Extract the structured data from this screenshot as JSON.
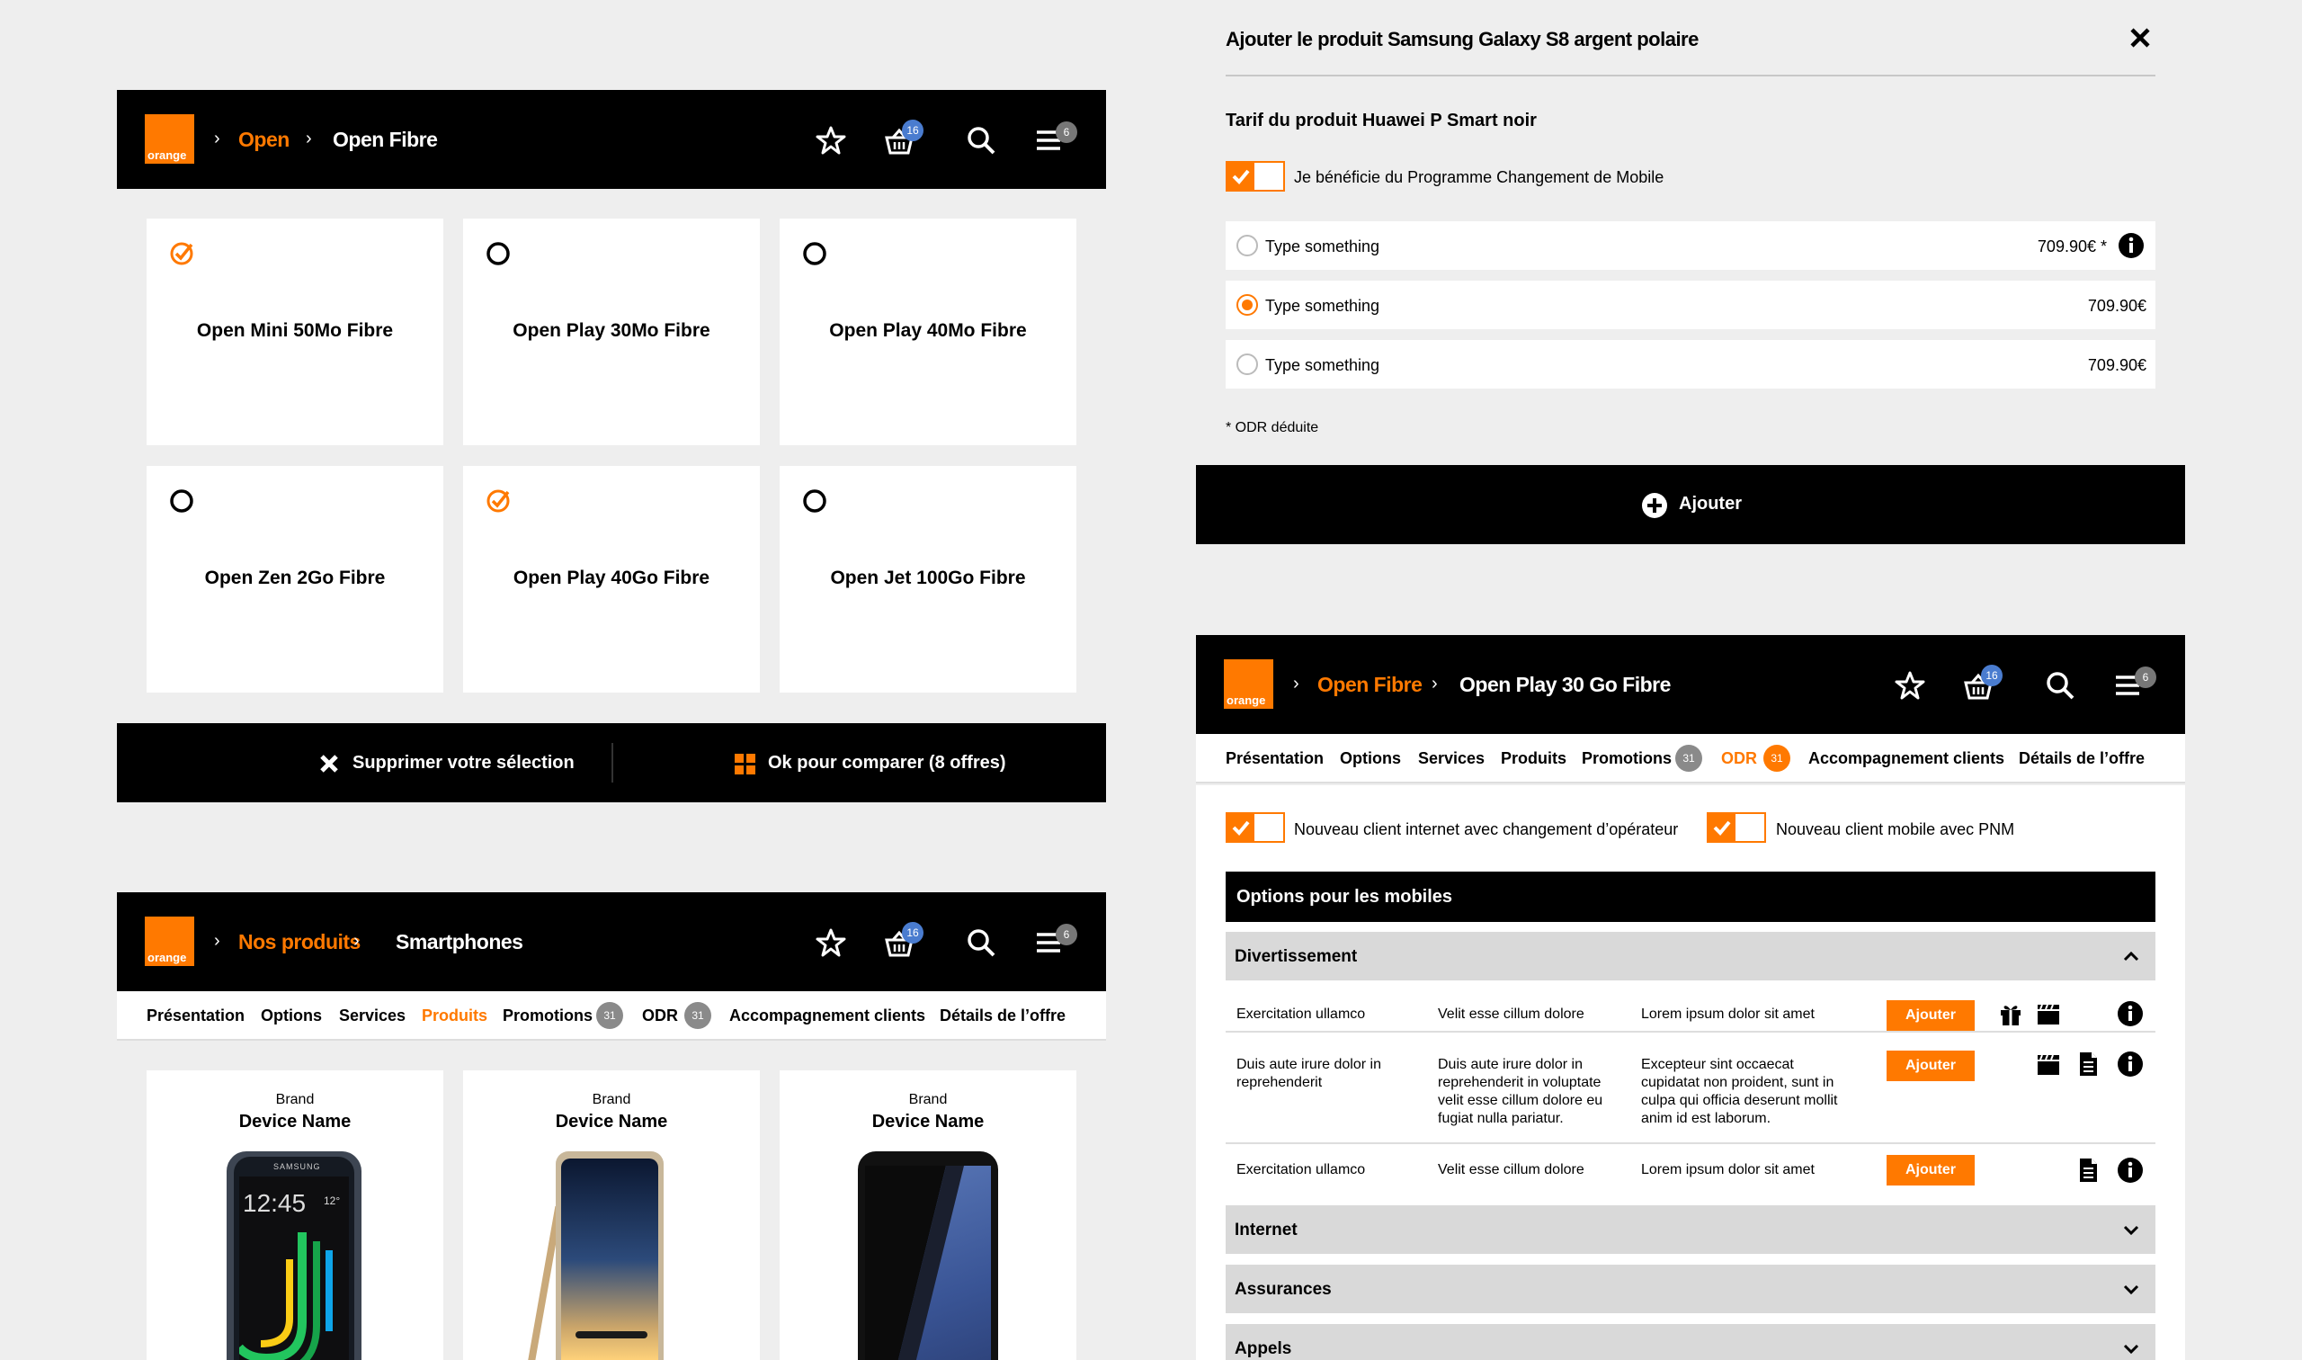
{
  "colors": {
    "orange": "#ff7900",
    "black": "#000000",
    "background": "#eeeeee",
    "badge_blue": "#4a7ccf",
    "badge_grey": "#8a8a8a"
  },
  "logo_text": "orange",
  "header1": {
    "crumb1": "Open",
    "crumb2": "Open Fibre",
    "basket_badge": "16",
    "menu_badge": "6"
  },
  "offers": [
    {
      "name": "Open Mini 50Mo Fibre",
      "selected": true
    },
    {
      "name": "Open Play 30Mo Fibre",
      "selected": false
    },
    {
      "name": "Open Play 40Mo Fibre",
      "selected": false
    },
    {
      "name": "Open Zen 2Go Fibre",
      "selected": false
    },
    {
      "name": "Open Play 40Go Fibre",
      "selected": true
    },
    {
      "name": "Open Jet 100Go Fibre",
      "selected": false
    }
  ],
  "compare_bar": {
    "remove_label": "Supprimer votre sélection",
    "compare_label": "Ok pour comparer (8 offres)"
  },
  "header2": {
    "crumb1": "Nos produits",
    "crumb2": "Smartphones",
    "basket_badge": "16",
    "menu_badge": "6"
  },
  "tabs1": {
    "items": [
      "Présentation",
      "Options",
      "Services",
      "Produits",
      "Promotions",
      "ODR",
      "Accompagnement clients",
      "Détails de l’offre"
    ],
    "promotions_count": "31",
    "odr_count": "31",
    "active": "Produits"
  },
  "devices": [
    {
      "brand": "Brand",
      "name": "Device Name",
      "screen_time": "12:45",
      "screen_temp": "12°",
      "maker": "SAMSUNG"
    },
    {
      "brand": "Brand",
      "name": "Device Name"
    },
    {
      "brand": "Brand",
      "name": "Device Name"
    }
  ],
  "add_product": {
    "title": "Ajouter le produit Samsung Galaxy S8 argent polaire",
    "subtitle": "Tarif du produit Huawei P Smart noir",
    "programme_label": "Je bénéficie du Programme Changement de Mobile",
    "rows": [
      {
        "label": "Type something",
        "price": "709.90€ *",
        "selected": false,
        "info": true
      },
      {
        "label": "Type something",
        "price": "709.90€",
        "selected": true,
        "info": false
      },
      {
        "label": "Type something",
        "price": "709.90€",
        "selected": false,
        "info": false
      }
    ],
    "footnote": "* ODR déduite",
    "add_label": "Ajouter"
  },
  "header3": {
    "crumb1": "Open Fibre",
    "crumb2": "Open Play 30 Go Fibre",
    "basket_badge": "16",
    "menu_badge": "6"
  },
  "tabs2": {
    "items": [
      "Présentation",
      "Options",
      "Services",
      "Produits",
      "Promotions",
      "ODR",
      "Accompagnement clients",
      "Détails de l’offre"
    ],
    "promotions_count": "31",
    "odr_count": "31",
    "active": "ODR"
  },
  "client_toggles": {
    "internet": "Nouveau client internet avec changement d’opérateur",
    "mobile": "Nouveau client mobile avec PNM"
  },
  "options_panel": {
    "title": "Options pour les mobiles",
    "sections": [
      "Divertissement",
      "Internet",
      "Assurances",
      "Appels"
    ],
    "rows": [
      {
        "c1": "Exercitation ullamco",
        "c2": "Velit esse cillum dolore",
        "c3": "Lorem ipsum dolor sit amet",
        "button": "Ajouter",
        "icons": [
          "gift-icon",
          "clapper-icon",
          "info-icon"
        ]
      },
      {
        "c1": "Duis aute irure dolor in reprehenderit",
        "c2": "Duis aute irure dolor in reprehenderit in voluptate velit esse cillum dolore eu fugiat nulla pariatur.",
        "c3": "Excepteur sint occaecat cupidatat non proident, sunt in culpa qui officia deserunt mollit anim id est laborum.",
        "button": "Ajouter",
        "icons": [
          "clapper-icon",
          "document-icon",
          "info-icon"
        ]
      },
      {
        "c1": "Exercitation ullamco",
        "c2": "Velit esse cillum dolore",
        "c3": "Lorem ipsum dolor sit amet",
        "button": "Ajouter",
        "icons": [
          "document-icon",
          "info-icon"
        ]
      }
    ]
  }
}
